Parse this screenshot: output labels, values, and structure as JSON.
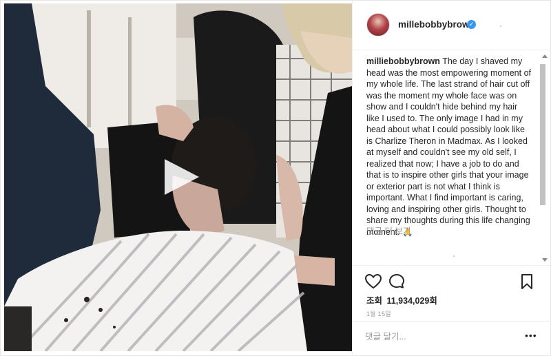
{
  "post": {
    "username": "millebobbybrown",
    "verified_badge": "✓",
    "caption_user": "milliebobbybrown",
    "caption_text": "The day I shaved my head was the most empowering moment of my whole life. The last strand of hair cut off was the moment my whole face was on show and I couldn't hide behind my hair like I used to. The only image I had in my head about what I could possibly look like is Charlize Theron in Madmax. As I looked at myself and couldn't see my old self, I realized that now; I have a job to do and that is to inspire other girls that your image or exterior part is not what I think is important. What I find important is caring, loving and inspiring other girls. Thought to share my thoughts during this life changing moment. 🙏",
    "more_comments": "댓글 더 보기",
    "views_label": "조회",
    "views_count": "11,934,029회",
    "date": "1월 15일",
    "comment_placeholder": "댓글 달기...",
    "comment_menu": "•••"
  },
  "icons": {
    "play": "play-icon",
    "like": "heart-icon",
    "comment": "speech-bubble-icon",
    "save": "bookmark-icon"
  },
  "colors": {
    "verified": "#3897f0",
    "text": "#262626",
    "muted": "#999999",
    "border": "#efefef"
  }
}
